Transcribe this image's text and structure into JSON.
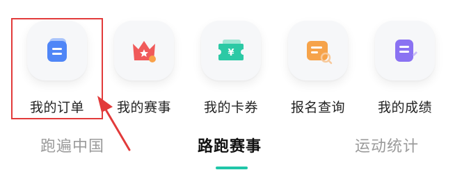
{
  "shortcuts": [
    {
      "label": "我的订单",
      "icon": "order-icon",
      "color": "#4f86f7"
    },
    {
      "label": "我的赛事",
      "icon": "crown-icon",
      "color": "#f05a5a"
    },
    {
      "label": "我的卡券",
      "icon": "ticket-icon",
      "color": "#2cc9a5"
    },
    {
      "label": "报名查询",
      "icon": "search-card-icon",
      "color": "#f6a34a"
    },
    {
      "label": "我的成绩",
      "icon": "score-icon",
      "color": "#8a72f2"
    }
  ],
  "tabs": [
    {
      "label": "跑遍中国",
      "active": false
    },
    {
      "label": "路跑赛事",
      "active": true
    },
    {
      "label": "运动统计",
      "active": false
    }
  ],
  "annotation": {
    "highlight_color": "#e23a3a"
  },
  "accent": "#1fc6a8"
}
